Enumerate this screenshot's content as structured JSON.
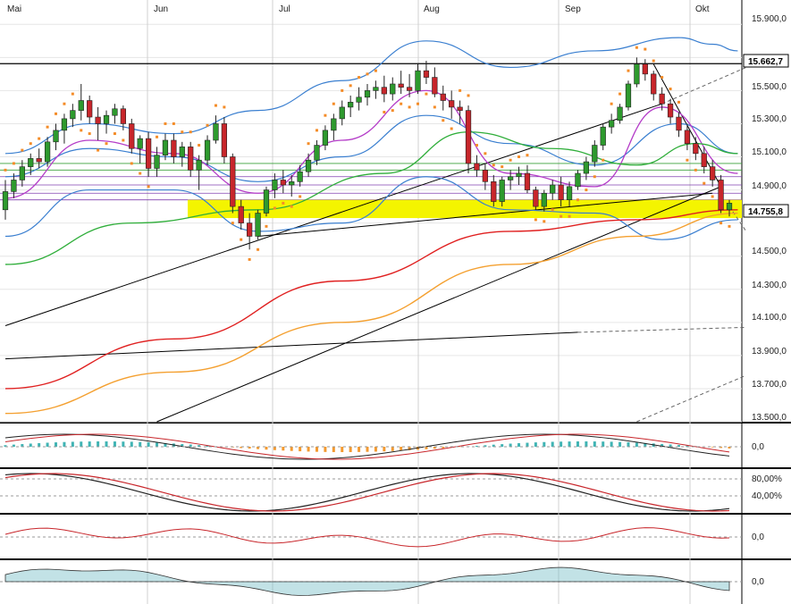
{
  "colors": {
    "up": "#2e9a2e",
    "down": "#c8262b",
    "bollinger": "#3a7fd0",
    "sma_violet": "#b43cc8",
    "sma_green": "#2fae3a",
    "sma_red": "#e02020",
    "sma_orange": "#f4a030",
    "psar": "#f48c28",
    "support_band": "#f4f400",
    "hist_teal": "#40b4b4",
    "hist_orange": "#f49a30"
  },
  "chart_data": {
    "type": "candlestick",
    "months": [
      "Mai",
      "Jun",
      "Jul",
      "Aug",
      "Sep",
      "Okt"
    ],
    "ylim": [
      13500,
      15950
    ],
    "yticks": [
      "15.900,0",
      "15.700,0",
      "15.500,0",
      "15.300,0",
      "15.100,0",
      "14.900,0",
      "14.700,0",
      "14.500,0",
      "14.300,0",
      "14.100,0",
      "13.900,0",
      "13.700,0",
      "13.500,0"
    ],
    "price_labels": [
      "15.662,7",
      "14.755,8"
    ],
    "ohlc": [
      [
        14780,
        14960,
        14720,
        14890
      ],
      [
        14890,
        15000,
        14850,
        14960
      ],
      [
        14960,
        15080,
        14920,
        15040
      ],
      [
        15040,
        15120,
        14990,
        15090
      ],
      [
        15090,
        15150,
        15030,
        15070
      ],
      [
        15070,
        15220,
        15040,
        15190
      ],
      [
        15190,
        15300,
        15140,
        15260
      ],
      [
        15260,
        15360,
        15180,
        15330
      ],
      [
        15330,
        15420,
        15280,
        15380
      ],
      [
        15380,
        15540,
        15320,
        15440
      ],
      [
        15440,
        15470,
        15300,
        15340
      ],
      [
        15340,
        15400,
        15200,
        15300
      ],
      [
        15300,
        15380,
        15240,
        15350
      ],
      [
        15350,
        15420,
        15300,
        15390
      ],
      [
        15390,
        15410,
        15260,
        15300
      ],
      [
        15300,
        15330,
        15120,
        15150
      ],
      [
        15150,
        15230,
        15060,
        15210
      ],
      [
        15210,
        15250,
        14980,
        15030
      ],
      [
        15030,
        15160,
        14980,
        15110
      ],
      [
        15110,
        15240,
        15080,
        15200
      ],
      [
        15200,
        15240,
        15060,
        15100
      ],
      [
        15100,
        15190,
        15040,
        15160
      ],
      [
        15160,
        15190,
        14980,
        15020
      ],
      [
        15020,
        15110,
        14900,
        15080
      ],
      [
        15080,
        15230,
        15050,
        15200
      ],
      [
        15200,
        15350,
        15180,
        15300
      ],
      [
        15300,
        15340,
        15060,
        15100
      ],
      [
        15100,
        15120,
        14760,
        14800
      ],
      [
        14800,
        14840,
        14660,
        14700
      ],
      [
        14700,
        14760,
        14540,
        14620
      ],
      [
        14620,
        14780,
        14600,
        14760
      ],
      [
        14760,
        14920,
        14740,
        14900
      ],
      [
        14900,
        15000,
        14850,
        14960
      ],
      [
        14960,
        15020,
        14880,
        14930
      ],
      [
        14930,
        14990,
        14860,
        14950
      ],
      [
        14950,
        15050,
        14920,
        15010
      ],
      [
        15010,
        15120,
        14980,
        15080
      ],
      [
        15080,
        15200,
        15050,
        15170
      ],
      [
        15170,
        15290,
        15140,
        15260
      ],
      [
        15260,
        15360,
        15200,
        15330
      ],
      [
        15330,
        15440,
        15290,
        15400
      ],
      [
        15400,
        15470,
        15340,
        15430
      ],
      [
        15430,
        15520,
        15380,
        15460
      ],
      [
        15460,
        15540,
        15410,
        15500
      ],
      [
        15500,
        15560,
        15450,
        15520
      ],
      [
        15520,
        15590,
        15430,
        15480
      ],
      [
        15480,
        15580,
        15440,
        15540
      ],
      [
        15540,
        15620,
        15480,
        15520
      ],
      [
        15520,
        15600,
        15460,
        15500
      ],
      [
        15500,
        15660,
        15480,
        15620
      ],
      [
        15620,
        15680,
        15540,
        15580
      ],
      [
        15580,
        15640,
        15460,
        15480
      ],
      [
        15480,
        15530,
        15380,
        15440
      ],
      [
        15440,
        15500,
        15330,
        15400
      ],
      [
        15400,
        15440,
        15300,
        15380
      ],
      [
        15380,
        15410,
        15000,
        15060
      ],
      [
        15060,
        15110,
        14980,
        15020
      ],
      [
        15020,
        15060,
        14900,
        14950
      ],
      [
        14950,
        14990,
        14800,
        14830
      ],
      [
        14830,
        14980,
        14800,
        14960
      ],
      [
        14960,
        15020,
        14900,
        14980
      ],
      [
        14980,
        15040,
        14930,
        15000
      ],
      [
        15000,
        15050,
        14880,
        14900
      ],
      [
        14900,
        14920,
        14780,
        14800
      ],
      [
        14800,
        14900,
        14770,
        14880
      ],
      [
        14880,
        14960,
        14840,
        14930
      ],
      [
        14930,
        14980,
        14800,
        14840
      ],
      [
        14840,
        14950,
        14800,
        14920
      ],
      [
        14920,
        15020,
        14900,
        15000
      ],
      [
        15000,
        15100,
        14960,
        15070
      ],
      [
        15070,
        15200,
        15040,
        15170
      ],
      [
        15170,
        15300,
        15140,
        15280
      ],
      [
        15280,
        15360,
        15240,
        15320
      ],
      [
        15320,
        15420,
        15300,
        15400
      ],
      [
        15400,
        15560,
        15380,
        15540
      ],
      [
        15540,
        15700,
        15520,
        15660
      ],
      [
        15660,
        15690,
        15560,
        15600
      ],
      [
        15600,
        15620,
        15440,
        15480
      ],
      [
        15480,
        15520,
        15380,
        15420
      ],
      [
        15420,
        15450,
        15300,
        15340
      ],
      [
        15340,
        15370,
        15220,
        15260
      ],
      [
        15260,
        15300,
        15140,
        15180
      ],
      [
        15180,
        15220,
        15080,
        15120
      ],
      [
        15120,
        15160,
        15000,
        15040
      ],
      [
        15040,
        15080,
        14920,
        14960
      ],
      [
        14960,
        14990,
        14760,
        14780
      ],
      [
        14780,
        14840,
        14740,
        14820
      ]
    ],
    "overlays": {
      "bollinger_upper": [
        [
          0,
          15120
        ],
        [
          10,
          15300
        ],
        [
          20,
          15240
        ],
        [
          30,
          15380
        ],
        [
          40,
          15560
        ],
        [
          50,
          15800
        ],
        [
          60,
          15640
        ],
        [
          70,
          15740
        ],
        [
          80,
          15820
        ],
        [
          84,
          15780
        ],
        [
          87,
          15740
        ]
      ],
      "bollinger_middle": [
        [
          0,
          14980
        ],
        [
          10,
          15150
        ],
        [
          20,
          15100
        ],
        [
          30,
          14950
        ],
        [
          40,
          15100
        ],
        [
          50,
          15350
        ],
        [
          60,
          15180
        ],
        [
          70,
          15050
        ],
        [
          80,
          15300
        ],
        [
          87,
          15120
        ]
      ],
      "bollinger_lower": [
        [
          0,
          14620
        ],
        [
          10,
          14900
        ],
        [
          20,
          14900
        ],
        [
          30,
          14650
        ],
        [
          40,
          14700
        ],
        [
          50,
          14980
        ],
        [
          60,
          14780
        ],
        [
          70,
          14760
        ],
        [
          78,
          14600
        ],
        [
          87,
          14720
        ]
      ],
      "sma_violet": [
        [
          0,
          14850
        ],
        [
          10,
          15200
        ],
        [
          20,
          15120
        ],
        [
          30,
          14880
        ],
        [
          40,
          15200
        ],
        [
          50,
          15500
        ],
        [
          60,
          15000
        ],
        [
          70,
          14920
        ],
        [
          78,
          15400
        ],
        [
          87,
          15000
        ]
      ],
      "sma_green": [
        [
          0,
          14450
        ],
        [
          15,
          14700
        ],
        [
          30,
          14780
        ],
        [
          45,
          15000
        ],
        [
          55,
          15250
        ],
        [
          65,
          15150
        ],
        [
          75,
          15050
        ],
        [
          82,
          15180
        ],
        [
          87,
          15120
        ]
      ],
      "sma_red": [
        [
          0,
          13700
        ],
        [
          20,
          14000
        ],
        [
          40,
          14350
        ],
        [
          60,
          14650
        ],
        [
          75,
          14720
        ],
        [
          87,
          14780
        ]
      ],
      "sma_orange": [
        [
          0,
          13550
        ],
        [
          20,
          13800
        ],
        [
          40,
          14100
        ],
        [
          60,
          14450
        ],
        [
          75,
          14620
        ],
        [
          87,
          14760
        ]
      ]
    },
    "trendlines": [
      {
        "kind": "solid",
        "from": [
          0,
          14080
        ],
        "to": [
          78,
          15420
        ]
      },
      {
        "kind": "solid",
        "from": [
          30,
          14620
        ],
        "to": [
          84,
          14880
        ]
      },
      {
        "kind": "solid",
        "from": [
          0,
          13880
        ],
        "to": [
          68,
          14040
        ]
      },
      {
        "kind": "solid",
        "from": [
          18,
          13500
        ],
        "to": [
          85,
          14920
        ]
      },
      {
        "kind": "solid",
        "from": [
          77,
          15660
        ],
        "to": [
          85,
          14920
        ]
      },
      {
        "kind": "dashed",
        "from": [
          68,
          14040
        ],
        "to": [
          88,
          14070
        ]
      },
      {
        "kind": "dashed",
        "from": [
          78,
          15420
        ],
        "to": [
          88,
          15640
        ]
      },
      {
        "kind": "dashed",
        "from": [
          75,
          13500
        ],
        "to": [
          88,
          13780
        ]
      },
      {
        "kind": "dashed",
        "from": [
          86,
          14800
        ],
        "to": [
          88,
          14650
        ]
      }
    ],
    "horizontal_levels": [
      15662.7,
      15060,
      15020,
      14980,
      14930,
      14880,
      14840
    ],
    "support_band": [
      14730,
      14840
    ],
    "panels": [
      {
        "name": "macd",
        "ticks": [
          "0,0"
        ]
      },
      {
        "name": "stochastic",
        "ticks": [
          "80,00%",
          "40,00%"
        ]
      },
      {
        "name": "oscillator",
        "ticks": [
          "0,0"
        ]
      },
      {
        "name": "momentum",
        "ticks": [
          "0,0"
        ]
      }
    ]
  }
}
